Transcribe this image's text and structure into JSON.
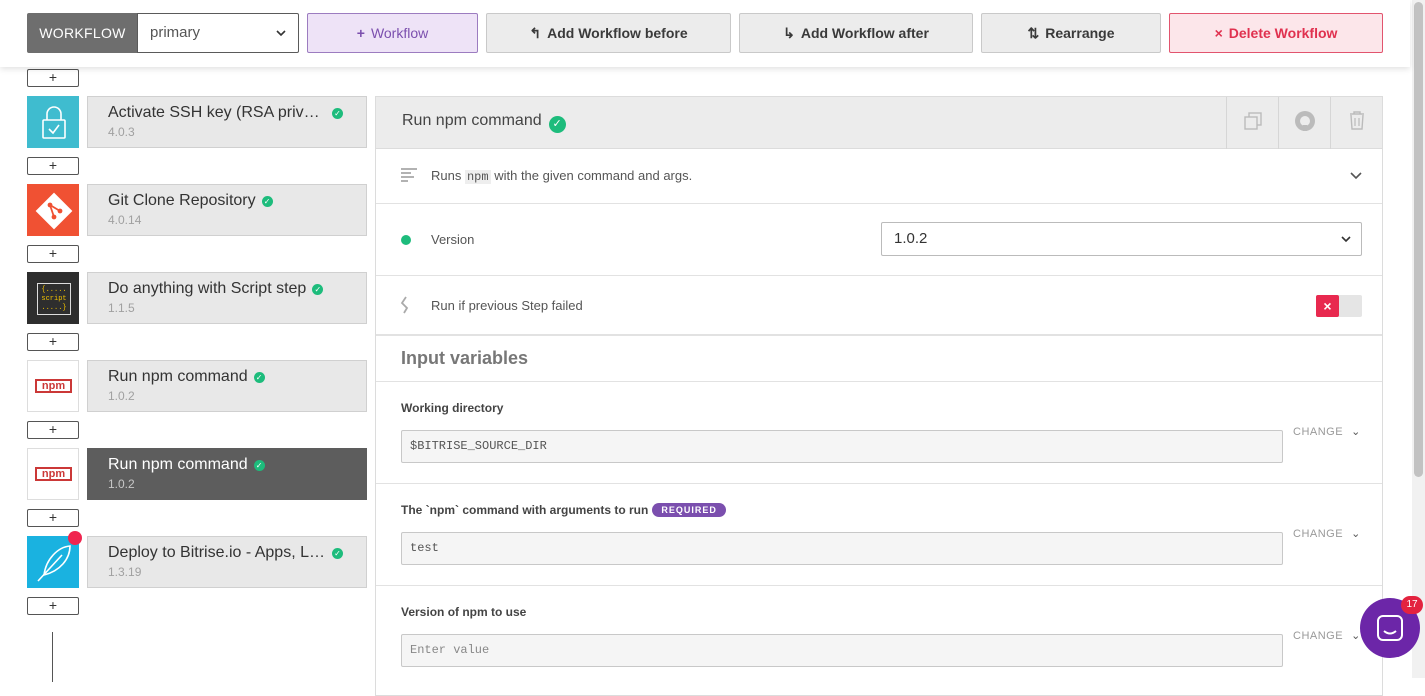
{
  "toolbar": {
    "workflow_label": "WORKFLOW",
    "workflow_selected": "primary",
    "add_workflow": "Workflow",
    "add_before": "Add Workflow before",
    "add_after": "Add Workflow after",
    "rearrange": "Rearrange",
    "delete": "Delete Workflow"
  },
  "insert_symbol": "+",
  "steps": [
    {
      "title": "Activate SSH key (RSA privat...",
      "version": "4.0.3",
      "icon": "lock-icon"
    },
    {
      "title": "Git Clone Repository",
      "version": "4.0.14",
      "icon": "git-icon"
    },
    {
      "title": "Do anything with Script step",
      "version": "1.1.5",
      "icon": "script-icon"
    },
    {
      "title": "Run npm command",
      "version": "1.0.2",
      "icon": "npm-icon"
    },
    {
      "title": "Run npm command",
      "version": "1.0.2",
      "icon": "npm-icon"
    },
    {
      "title": "Deploy to Bitrise.io - Apps, Lo...",
      "version": "1.3.19",
      "icon": "feather-icon"
    }
  ],
  "script_icon_text": [
    "{.....",
    "script",
    ".....}"
  ],
  "npm_icon_text": "npm",
  "detail": {
    "name": "Run npm command",
    "desc_before": "Runs",
    "desc_code": "npm",
    "desc_after": "with the given command and args.",
    "version_label": "Version",
    "version_value": "1.0.2",
    "run_if_failed": "Run if previous Step failed",
    "section_title": "Input variables",
    "inputs": [
      {
        "label": "Working directory",
        "value": "$BITRISE_SOURCE_DIR",
        "required": false
      },
      {
        "label": "The `npm` command with arguments to run",
        "value": "test",
        "required": true
      },
      {
        "label": "Version of npm to use",
        "placeholder": "Enter value",
        "required": false
      }
    ],
    "required_badge": "REQUIRED",
    "change_label": "CHANGE"
  },
  "chat_badge": "17",
  "colors": {
    "accent_purple": "#7b4fae",
    "danger": "#e0314f",
    "success": "#1dbc7c"
  }
}
